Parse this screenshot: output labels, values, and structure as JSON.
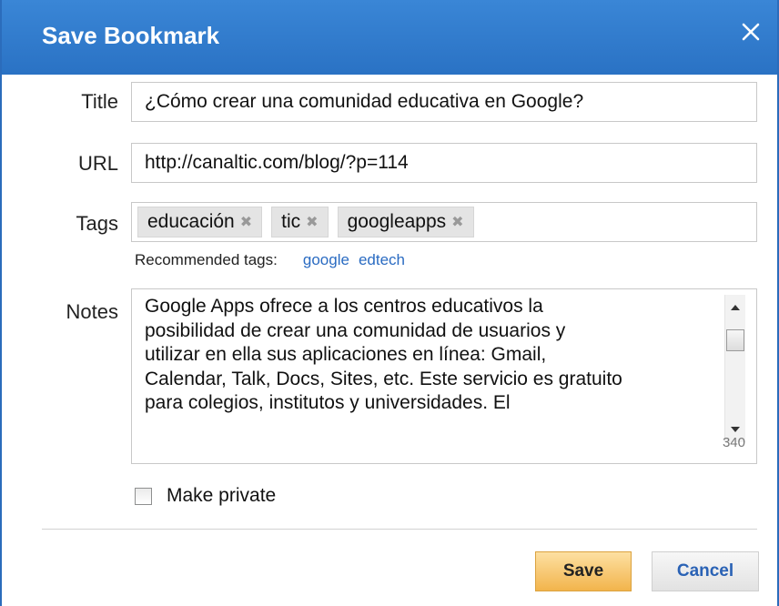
{
  "dialog": {
    "title": "Save Bookmark"
  },
  "fields": {
    "title_label": "Title",
    "title_value": "¿Cómo crear una comunidad educativa en Google?",
    "url_label": "URL",
    "url_value": "http://canaltic.com/blog/?p=114",
    "tags_label": "Tags",
    "tags": [
      "educación",
      "tic",
      "googleapps"
    ],
    "notes_label": "Notes",
    "notes_lines": [
      "Google Apps ofrece a los centros educativos la",
      "posibilidad de crear una comunidad de usuarios y",
      "utilizar en ella sus aplicaciones en línea: Gmail,",
      "Calendar, Talk, Docs, Sites, etc. Este servicio es gratuito",
      "para colegios, institutos y universidades. El"
    ],
    "notes_count": "340"
  },
  "recommended": {
    "label": "Recommended tags:",
    "tags": [
      "google",
      "edtech"
    ]
  },
  "private": {
    "label": "Make private",
    "checked": false
  },
  "buttons": {
    "save": "Save",
    "cancel": "Cancel"
  },
  "colors": {
    "titlebar": "#2a72c4",
    "link": "#2a6bc2",
    "save_button": "#f2b44c"
  },
  "icons": {
    "close": "close-icon",
    "tag_remove": "tag-remove-icon"
  }
}
